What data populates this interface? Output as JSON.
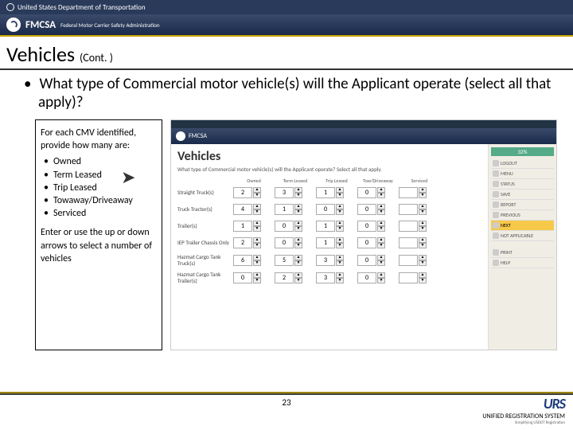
{
  "header": {
    "dept": "United States Department of Transportation",
    "agency": "FMCSA",
    "agency_sub": "Federal Motor Carrier Safety Administration"
  },
  "slide": {
    "title": "Vehicles",
    "cont": "(Cont. )",
    "bullet": "What type of Commercial motor vehicle(s) will the Applicant operate (select all that apply)?",
    "page_num": "23"
  },
  "info_box": {
    "lead": "For each CMV identified, provide how many are:",
    "items": [
      "Owned",
      "Term Leased",
      "Trip Leased",
      "Towaway/Driveaway",
      "Serviced"
    ],
    "note": "Enter or use the up or down arrows to select a number of vehicles"
  },
  "screenshot": {
    "title": "Vehicles",
    "question": "What type of Commercial motor vehicle(s) will the Applicant operate? Select all that apply.",
    "columns": [
      "Owned",
      "Term Leased",
      "Trip Leased",
      "Tow/Driveaway",
      "Serviced"
    ],
    "rows": [
      {
        "label": "Straight Truck(s)",
        "vals": [
          "2",
          "3",
          "1",
          "0",
          ""
        ]
      },
      {
        "label": "Truck Tractor(s)",
        "vals": [
          "4",
          "1",
          "0",
          "0",
          ""
        ]
      },
      {
        "label": "Trailer(s)",
        "vals": [
          "1",
          "0",
          "1",
          "0",
          ""
        ]
      },
      {
        "label": "IEP Trailer Chassis Only",
        "vals": [
          "2",
          "0",
          "1",
          "0",
          ""
        ]
      },
      {
        "label": "Hazmat Cargo Tank Truck(s)",
        "vals": [
          "6",
          "5",
          "3",
          "0",
          ""
        ]
      },
      {
        "label": "Hazmat Cargo Tank Trailer(s)",
        "vals": [
          "0",
          "2",
          "3",
          "0",
          ""
        ]
      }
    ],
    "sidebar": {
      "progress": "32%",
      "items": [
        "LOGOUT",
        "MENU",
        "STATUS",
        "SAVE",
        "REPORT",
        "PREVIOUS",
        "NEXT",
        "NOT APPLICABLE"
      ],
      "highlight_index": 6,
      "bottom": [
        "PRINT",
        "HELP"
      ]
    }
  },
  "urs": {
    "brand": "URS",
    "name": "UNIFIED REGISTRATION SYSTEM",
    "tag": "Simplifying USDOT Registration"
  }
}
